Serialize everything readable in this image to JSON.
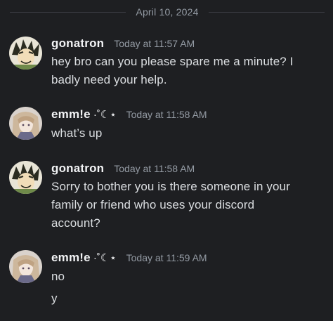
{
  "date_divider": "April 10, 2024",
  "messages": [
    {
      "username": "gonatron",
      "timestamp": "Today at 11:57 AM",
      "lines": [
        "hey bro can you please spare me a minute? I",
        "badly need your help."
      ]
    },
    {
      "username": "emm!e",
      "username_suffix": "·˚☾⋆",
      "timestamp": "Today at 11:58 AM",
      "lines": [
        "what’s up"
      ]
    },
    {
      "username": "gonatron",
      "timestamp": "Today at 11:58 AM",
      "lines": [
        "Sorry to bother you is there someone in your",
        "family or friend who uses your discord",
        "account?"
      ]
    },
    {
      "username": "emm!e",
      "username_suffix": "·˚☾⋆",
      "timestamp": "Today at 11:59 AM",
      "lines": [
        "no"
      ],
      "followup": "y"
    }
  ],
  "colors": {
    "background": "#1e1f22",
    "text": "#dbdee1",
    "muted": "#949ba4",
    "username": "#f2f3f5"
  }
}
